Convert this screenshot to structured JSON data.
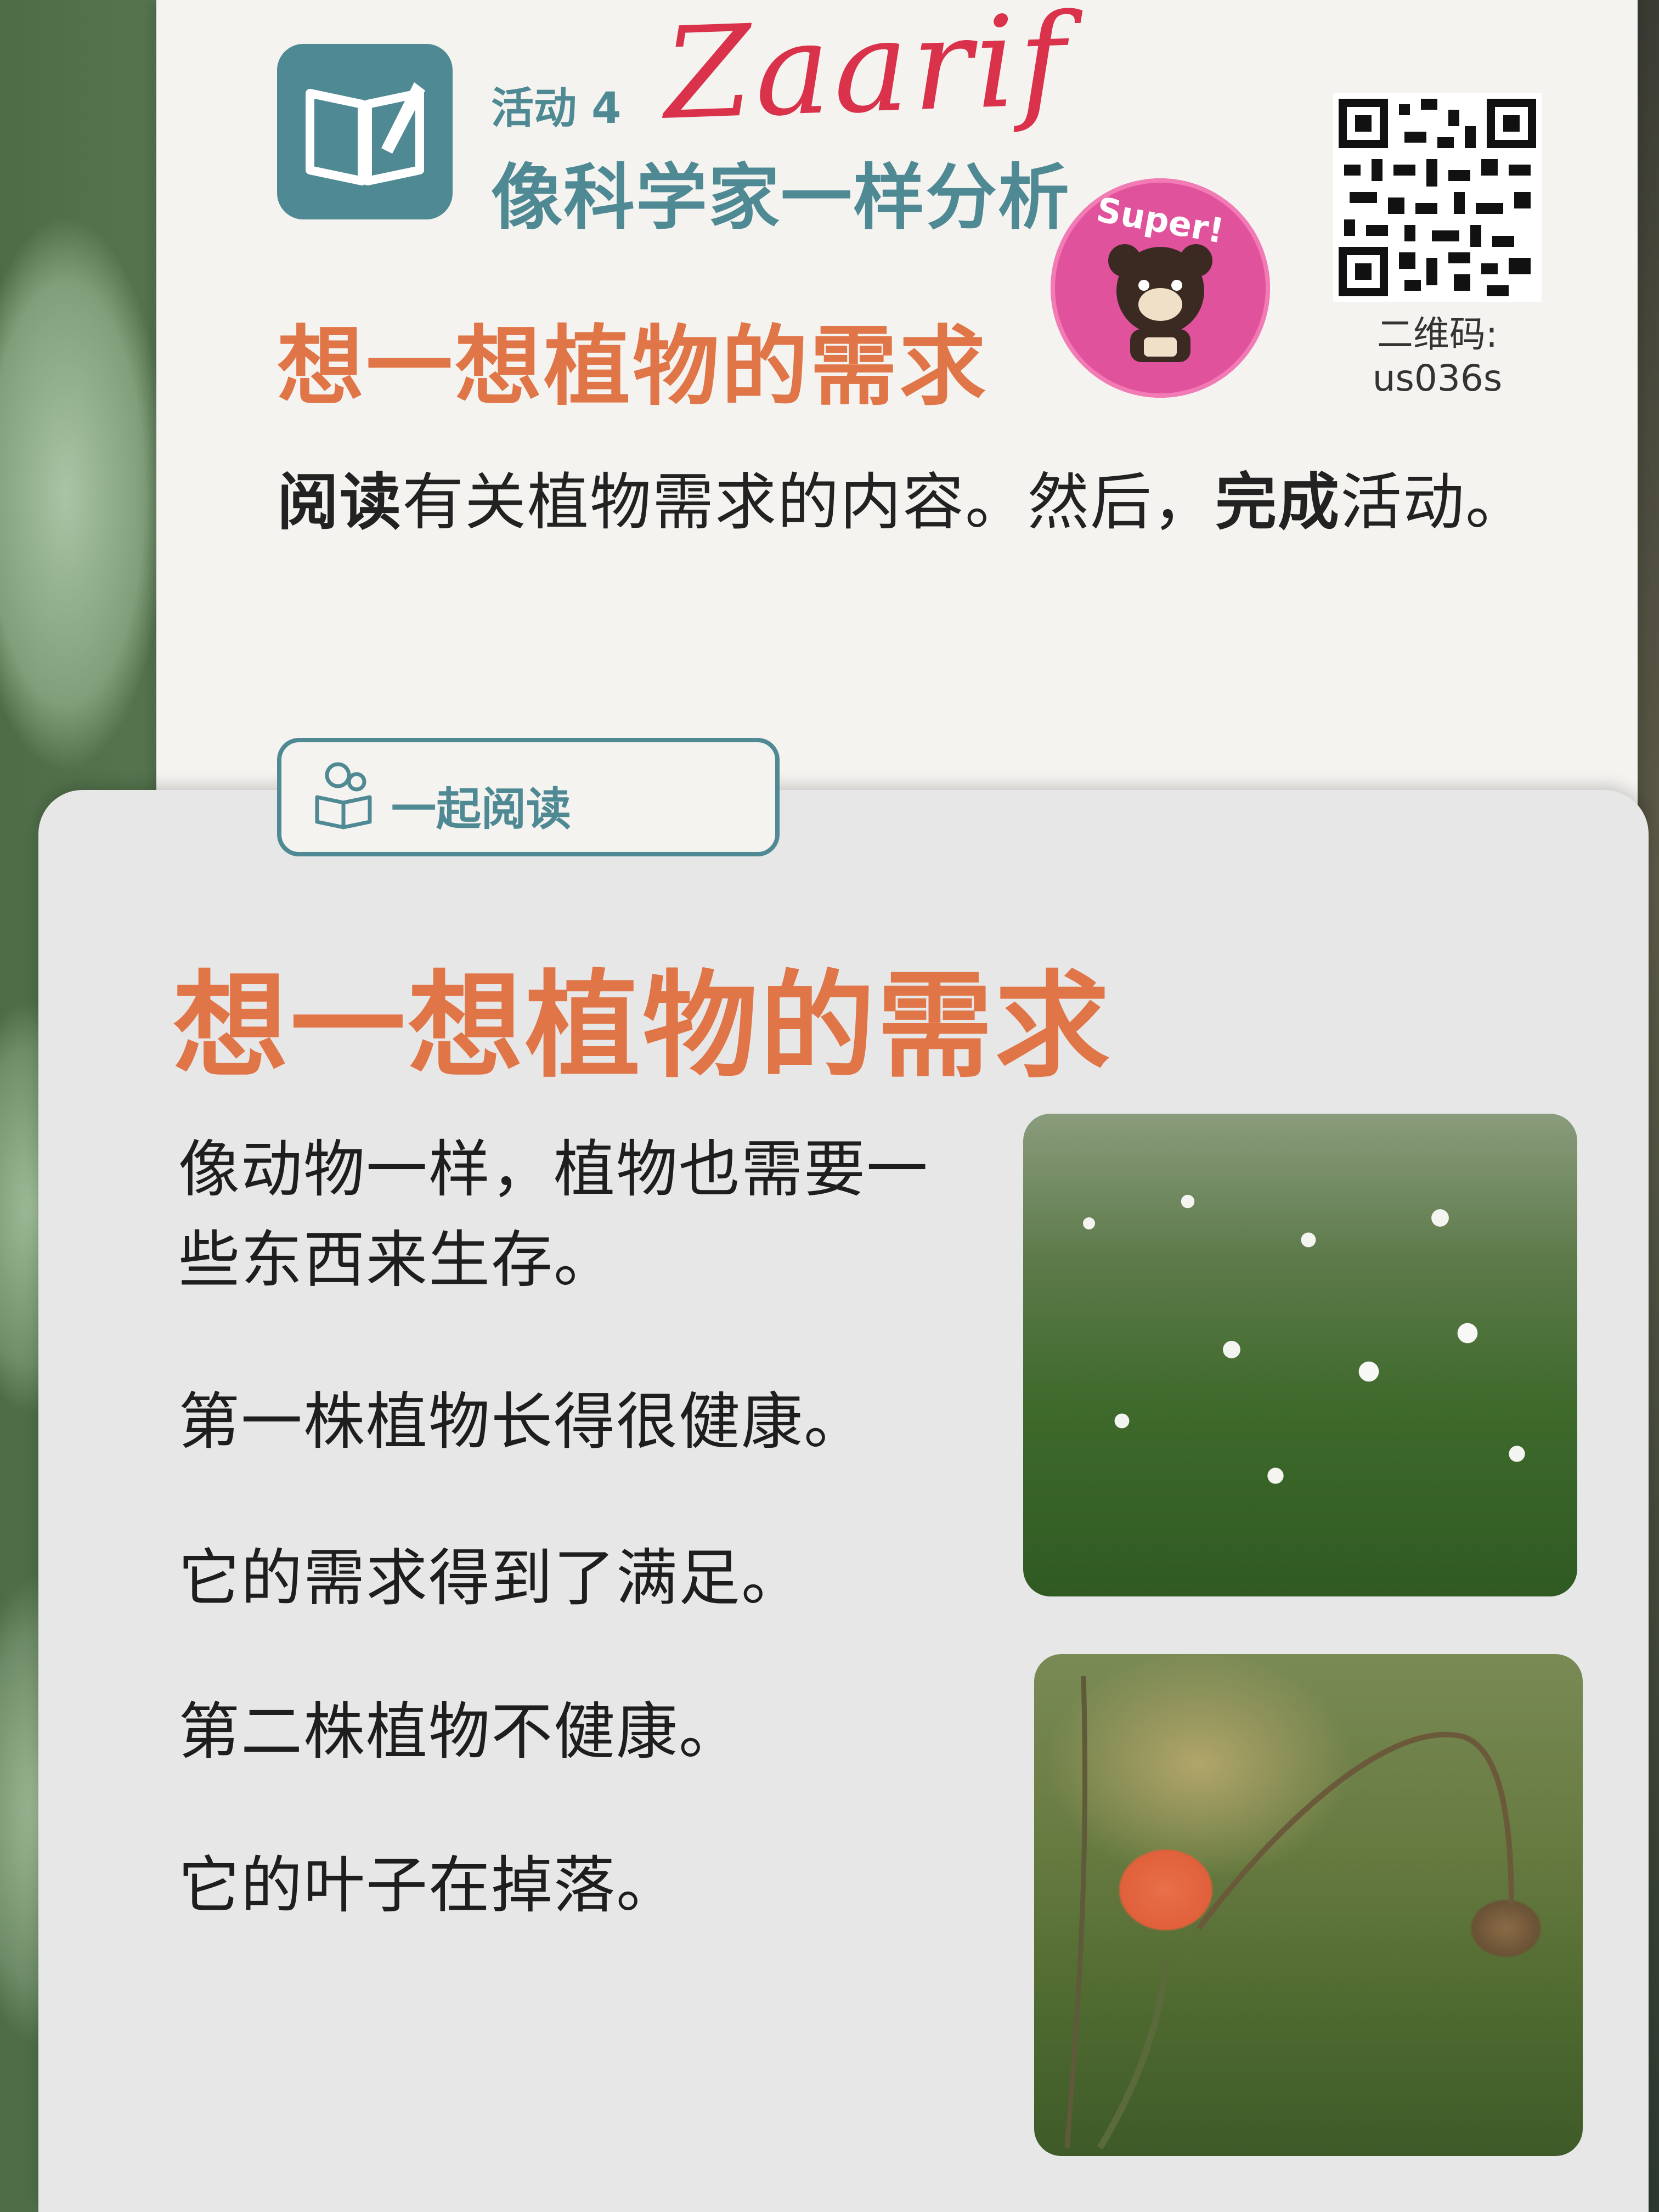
{
  "header": {
    "activity_number": "活动 4",
    "activity_title": "像科学家一样分析",
    "student_name": "Zaarif",
    "sticker_text": "Super!",
    "qr_label_line1": "二维码:",
    "qr_label_line2": "us036s"
  },
  "top_section": {
    "title": "想一想植物的需求",
    "instruction_bold_1": "阅读",
    "instruction_text_1": "有关植物需求的内容。然后，",
    "instruction_bold_2": "完成",
    "instruction_text_2": "活动。"
  },
  "read_tab": {
    "label": "一起阅读"
  },
  "reading": {
    "title": "想一想植物的需求",
    "paragraph_1_line_1": "像动物一样，植物也需要一",
    "paragraph_1_line_2": "些东西来生存。",
    "paragraph_2": "第一株植物长得很健康。",
    "paragraph_3": "它的需求得到了满足。",
    "paragraph_4": "第二株植物不健康。",
    "paragraph_5": "它的叶子在掉落。"
  },
  "colors": {
    "teal": "#4f8a94",
    "orange": "#e07548",
    "sticker_pink": "#e0529b",
    "marker_red": "#d9324a"
  },
  "icons": [
    "open-book-icon",
    "bear-sticker-icon",
    "qr-code-icon",
    "reading-child-icon"
  ]
}
